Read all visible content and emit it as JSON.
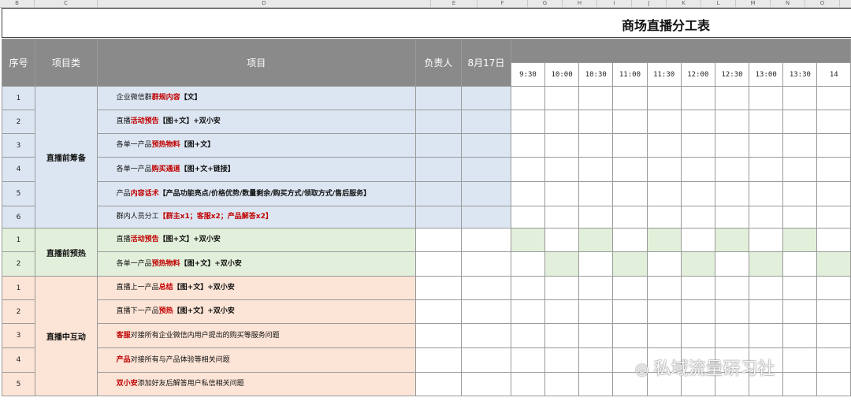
{
  "column_letters": [
    "B",
    "C",
    "D",
    "E",
    "F",
    "G",
    "H",
    "I",
    "J",
    "K",
    "L",
    "M",
    "N",
    "O"
  ],
  "title": "商场直播分工表",
  "headers": {
    "seq": "序号",
    "category": "项目类",
    "item": "项目",
    "owner": "负责人",
    "date": "8月17日"
  },
  "times": [
    "9:30",
    "10:00",
    "10:30",
    "11:00",
    "11:30",
    "12:00",
    "12:30",
    "13:00",
    "13:30",
    "14"
  ],
  "groups": [
    {
      "category": "直播前筹备",
      "color": "#dce6f2",
      "rows": [
        {
          "num": "1",
          "pre": "企业微信群",
          "hl": "群规内容",
          "post": "【文】"
        },
        {
          "num": "2",
          "pre": "直播",
          "hl": "活动预告",
          "post": "【图+文】+双小安"
        },
        {
          "num": "3",
          "pre": "各单一产品",
          "hl": "预热物料",
          "post": "【图+文】"
        },
        {
          "num": "4",
          "pre": "各单一产品",
          "hl": "购买通道",
          "post": "【图+文+链接】"
        },
        {
          "num": "5",
          "pre": "产品",
          "hl": "内容话术",
          "post": "【产品功能亮点/价格优势/数量剩余/购买方式/领取方式/售后服务】"
        },
        {
          "num": "6",
          "pre": "群内人员分工",
          "hl": "【群主x1；客服x2；产品解答x2】",
          "post": ""
        }
      ]
    },
    {
      "category": "直播前预热",
      "color": "#e2efda",
      "rows": [
        {
          "num": "1",
          "pre": "直播",
          "hl": "活动预告",
          "post": "【图+文】+双小安"
        },
        {
          "num": "2",
          "pre": "各单一产品",
          "hl": "预热物料",
          "post": "【图+文】+双小安"
        }
      ]
    },
    {
      "category": "直播中互动",
      "color": "#fce4d6",
      "rows": [
        {
          "num": "1",
          "pre": "直播上一产品",
          "hl": "总结",
          "post": "【图+文】+双小安"
        },
        {
          "num": "2",
          "pre": "直播下一产品",
          "hl": "预热",
          "post": "【图+文】+双小安"
        },
        {
          "num": "3",
          "pre": "",
          "hl": "客服",
          "post": "对接所有企业微信内用户提出的购买等服务问题"
        },
        {
          "num": "4",
          "pre": "",
          "hl": "产品",
          "post": "对接所有与产品体验等相关问题"
        },
        {
          "num": "5",
          "pre": "",
          "hl": "双小安",
          "post": "添加好友后解答用户私信相关问题"
        }
      ]
    }
  ],
  "shading": {
    "green_row1": [
      0,
      2,
      4,
      6,
      8
    ],
    "green_row2": [
      1,
      3,
      5,
      7,
      9
    ]
  },
  "watermark": "私域流量研习社",
  "watermark_icon": "wechat-icon"
}
